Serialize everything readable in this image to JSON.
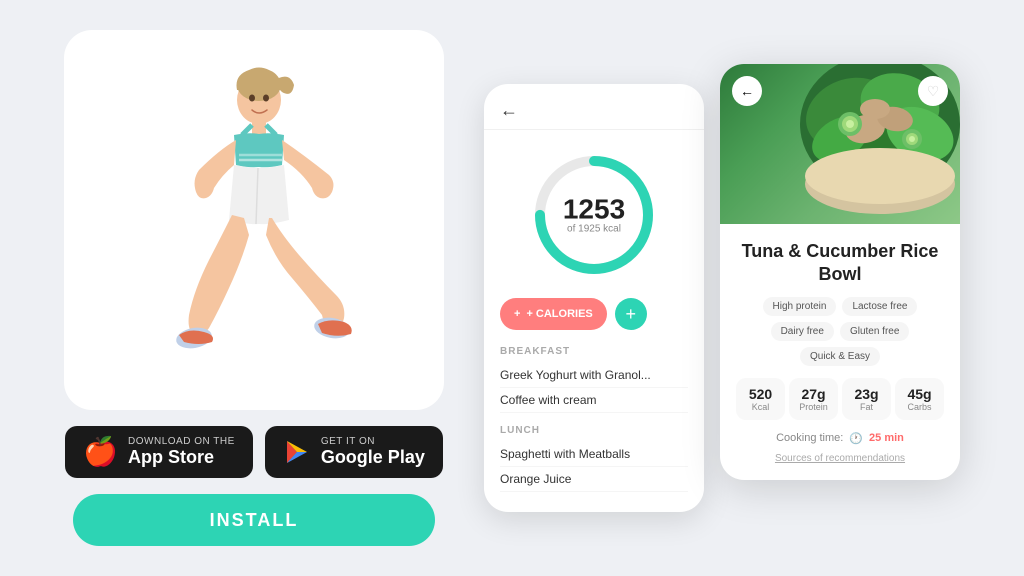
{
  "app": {
    "background_color": "#eef0f4"
  },
  "left_section": {
    "app_store": {
      "sub_label": "Download on the",
      "main_label": "App Store",
      "icon": "🍎"
    },
    "google_play": {
      "sub_label": "GET IT ON",
      "main_label": "Google Play",
      "icon": "▶"
    },
    "install_button": "INSTALL"
  },
  "phone1": {
    "back_arrow": "←",
    "calorie_number": "1253",
    "calorie_of": "of 1925 kcal",
    "add_calories_label": "+ CALORIES",
    "breakfast_label": "BREAKFAST",
    "breakfast_items": [
      "Greek Yoghurt with Granol...",
      "Coffee with cream"
    ],
    "lunch_label": "LUNCH",
    "lunch_items": [
      "Spaghetti with Meatballs",
      "Orange Juice"
    ]
  },
  "phone2": {
    "back_arrow": "←",
    "heart_icon": "♡",
    "recipe_title": "Tuna & Cucumber Rice Bowl",
    "tags": [
      "High protein",
      "Lactose free",
      "Dairy free",
      "Gluten free",
      "Quick & Easy"
    ],
    "nutrition": [
      {
        "value": "520",
        "label": "Kcal"
      },
      {
        "value": "27g",
        "label": "Protein"
      },
      {
        "value": "23g",
        "label": "Fat"
      },
      {
        "value": "45g",
        "label": "Carbs"
      }
    ],
    "cooking_time_label": "Cooking time:",
    "cooking_time_value": "25 min",
    "sources_label": "Sources of recommendations"
  }
}
